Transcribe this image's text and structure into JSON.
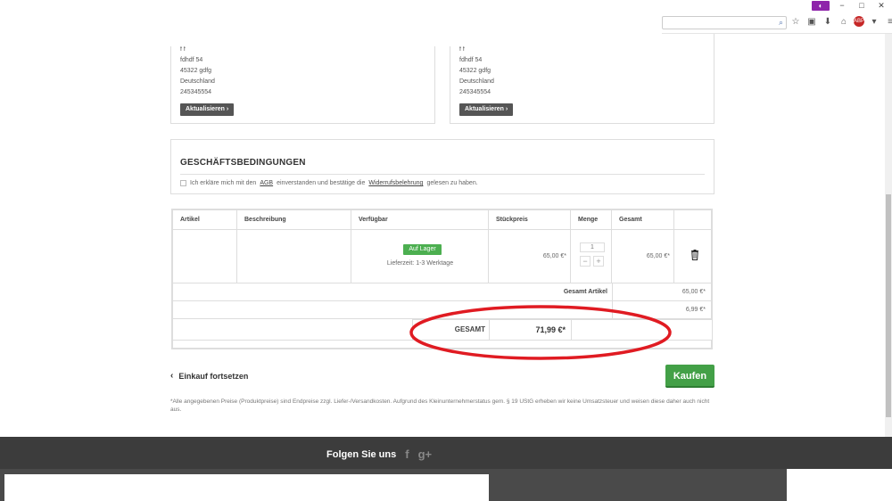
{
  "browser": {
    "win_minimize": "−",
    "win_maximize": "□",
    "win_close": "✕",
    "mask_badge": "◐"
  },
  "addresses": {
    "left": {
      "lines": [
        "f f",
        "fdhdf 54",
        "45322 gdfg",
        "Deutschland",
        "245345554"
      ],
      "button": "Aktualisieren"
    },
    "right": {
      "lines": [
        "f f",
        "fdhdf 54",
        "45322 gdfg",
        "Deutschland",
        "245345554"
      ],
      "button": "Aktualisieren"
    }
  },
  "terms": {
    "title": "GESCHÄFTSBEDINGUNGEN",
    "text_before": "Ich erkläre mich mit den",
    "agb_link": "AGB",
    "text_middle": "einverstanden und bestätige die",
    "widerruf_link": "Widerrufsbelehrung",
    "text_after": "gelesen zu haben."
  },
  "cart": {
    "headers": {
      "artikel": "Artikel",
      "beschreibung": "Beschreibung",
      "verfuegbar": "Verfügbar",
      "stueckpreis": "Stückpreis",
      "menge": "Menge",
      "gesamt": "Gesamt"
    },
    "item": {
      "stock_badge": "Auf Lager",
      "delivery": "Lieferzeit: 1-3 Werktage",
      "unit_price": "65,00 €*",
      "quantity": "1",
      "total": "65,00 €*"
    },
    "subtotal_label": "Gesamt Artikel",
    "subtotal_value": "65,00 €*",
    "shipping_value": "6,99 €*",
    "total_label": "GESAMT",
    "total_value": "71,99 €*"
  },
  "actions": {
    "continue_label": "Einkauf fortsetzen",
    "buy_label": "Kaufen"
  },
  "disclaimer": "*Alle angegebenen Preise (Produktpreise) sind Endpreise zzgl. Liefer-/Versandkosten. Aufgrund des Kleinunternehmerstatus gem. § 19 UStG erheben wir keine Umsatzsteuer und weisen diese daher auch nicht aus.",
  "footer": {
    "follow_label": "Folgen Sie uns",
    "facebook": "f",
    "googleplus": "g+"
  },
  "colors": {
    "buy_button": "#43a047",
    "stock_badge": "#4caf50",
    "footer_bg": "#3c3c3c",
    "annotation": "#e01b22"
  }
}
